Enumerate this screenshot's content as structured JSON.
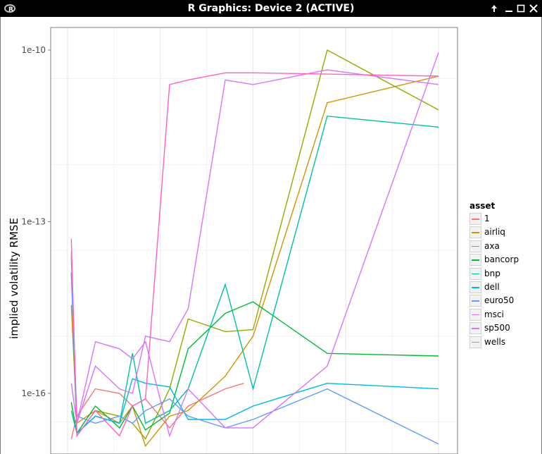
{
  "window": {
    "title": "R Graphics: Device 2 (ACTIVE)",
    "app_icon": "r-logo-icon",
    "controls": [
      "arrow-up-icon",
      "minimize-icon",
      "maximize-icon",
      "close-icon"
    ]
  },
  "colors": {
    "titlebar": "#000000",
    "panel_background": "#ffffff",
    "grid": "#ebebeb",
    "panel_border": "#7f7f7f"
  },
  "chart_data": {
    "type": "line",
    "title": "",
    "xlabel": "",
    "ylabel": "implied volatility RMSE",
    "y_scale": "log10",
    "y_ticks": [
      "1e-10",
      "1e-13",
      "1e-16"
    ],
    "y_tick_values": [
      1e-10,
      1e-13,
      1e-16
    ],
    "ylim": [
      5e-18,
      2e-10
    ],
    "xlim": [
      0,
      20
    ],
    "x_ticks_shown": false,
    "grid": true,
    "legend": {
      "title": "asset",
      "position": "right"
    },
    "series": [
      {
        "name": "1",
        "color": "#F8766D",
        "x": [
          0.2,
          0.5,
          1.5,
          2.8,
          3.5,
          4.2,
          5.5,
          6.5,
          8.5,
          9.5
        ],
        "y": [
          1.6e-17,
          4e-17,
          1.2e-16,
          1e-16,
          6e-17,
          8e-17,
          2.5e-17,
          6e-17,
          1.2e-16,
          1.5e-16
        ]
      },
      {
        "name": "airliq",
        "color": "#D39200",
        "x": [
          0.2,
          0.5,
          1.5,
          2.8,
          3.5,
          4.2,
          5.5,
          6.5,
          8.5,
          10,
          14,
          20
        ],
        "y": [
          3.5e-15,
          3e-17,
          5e-17,
          3e-17,
          6e-17,
          1.2e-17,
          4e-17,
          5e-17,
          2e-16,
          1e-15,
          1.2e-11,
          3.5e-11
        ]
      },
      {
        "name": "axa",
        "color": "#93AA00",
        "x": [
          0.2,
          0.5,
          1.5,
          2.8,
          3.5,
          4.2,
          5.5,
          6.5,
          8.5,
          10,
          14,
          20
        ],
        "y": [
          2.5e-14,
          1.8e-17,
          5e-17,
          4e-17,
          3e-17,
          1.6e-17,
          1.2e-16,
          2e-15,
          1.2e-15,
          1.3e-15,
          1e-10,
          9e-12
        ]
      },
      {
        "name": "bancorp",
        "color": "#00BA38",
        "x": [
          0.2,
          0.5,
          1.5,
          2.8,
          3.5,
          4.2,
          5.5,
          6.5,
          8.5,
          10,
          14,
          20
        ],
        "y": [
          7e-17,
          2e-17,
          6e-17,
          2.5e-17,
          6e-17,
          2.3e-17,
          4.5e-17,
          6e-16,
          2.5e-15,
          4e-15,
          5e-16,
          4.5e-16
        ]
      },
      {
        "name": "bnp",
        "color": "#00C19F",
        "x": [
          0.2,
          0.5,
          1.5,
          2.8,
          3.5,
          4.2,
          5.5,
          6.5,
          8.5,
          10,
          14,
          20
        ],
        "y": [
          5e-17,
          2e-17,
          4e-17,
          3e-17,
          5e-16,
          3e-17,
          5e-17,
          1.2e-16,
          8e-15,
          1.2e-16,
          7e-12,
          4.5e-12
        ]
      },
      {
        "name": "dell",
        "color": "#00B9E3",
        "x": [
          0.2,
          0.5,
          1.5,
          2.8,
          3.5,
          4.2,
          5.5,
          6.5,
          8.5,
          10,
          14,
          20
        ],
        "y": [
          1.3e-14,
          2e-17,
          4e-17,
          3e-17,
          1.8e-16,
          1.5e-16,
          1.3e-16,
          3.5e-17,
          3.5e-17,
          6e-17,
          1.5e-16,
          1.2e-16
        ]
      },
      {
        "name": "euro50",
        "color": "#619CFF",
        "x": [
          0.2,
          0.5,
          1.5,
          2.8,
          3.5,
          4.2,
          5.5,
          6.5,
          8.5,
          10,
          14,
          20
        ],
        "y": [
          1.2e-14,
          4e-17,
          3e-17,
          4e-17,
          3e-17,
          5e-17,
          8e-17,
          4e-17,
          2.5e-17,
          3.5e-17,
          1.2e-16,
          1.3e-17
        ]
      },
      {
        "name": "msci",
        "color": "#DB72FB",
        "x": [
          0.2,
          0.5,
          1.5,
          2.8,
          3.5,
          4.2,
          5.5,
          6.5,
          8.5,
          10,
          14,
          20
        ],
        "y": [
          3e-14,
          3e-17,
          3e-16,
          1.2e-16,
          1e-16,
          1e-15,
          8e-16,
          3e-15,
          3e-11,
          2.5e-11,
          4.5e-11,
          2.5e-11
        ]
      },
      {
        "name": "sp500",
        "color": "#D575FE",
        "x": [
          0.2,
          0.5,
          1.5,
          2.8,
          3.5,
          4.2,
          5.5,
          6.5,
          8.5,
          10,
          14,
          20
        ],
        "y": [
          1.5e-16,
          3e-17,
          8e-16,
          6e-16,
          4e-16,
          8e-16,
          1.8e-17,
          1.2e-16,
          2.5e-17,
          2.5e-17,
          3e-16,
          9e-11
        ]
      },
      {
        "name": "wells",
        "color": "#FF61C3",
        "x": [
          0.2,
          0.5,
          1.5,
          2.8,
          3.5,
          4.2,
          5.5,
          6.5,
          8.5,
          10,
          14,
          20
        ],
        "y": [
          5e-14,
          1.8e-17,
          5e-17,
          1.8e-17,
          6e-17,
          8e-17,
          2.5e-11,
          3e-11,
          4e-11,
          4e-11,
          3.8e-11,
          3.5e-11
        ]
      }
    ]
  }
}
